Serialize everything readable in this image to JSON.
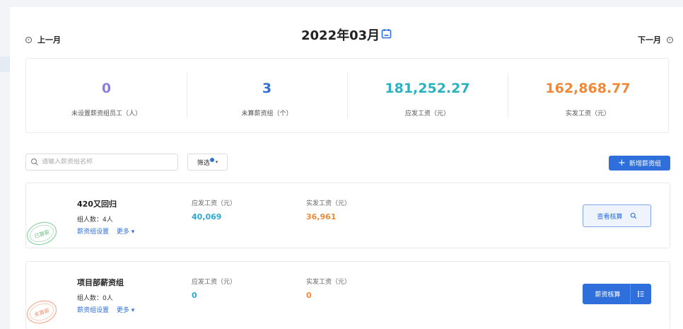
{
  "header": {
    "prev_label": "上一月",
    "month": "2022年03月",
    "next_label": "下一月"
  },
  "stats": [
    {
      "value": "0",
      "label": "未设置薪资组员工（人）",
      "color": "#8a7fe0"
    },
    {
      "value": "3",
      "label": "未算薪资组（个）",
      "color": "#2f6fdc"
    },
    {
      "value": "181,252.27",
      "label": "应发工资（元）",
      "color": "#2ab3bf"
    },
    {
      "value": "162,868.77",
      "label": "实发工资（元）",
      "color": "#f0883a"
    }
  ],
  "toolbar": {
    "search_placeholder": "请输入薪资组名称",
    "filter_label": "筛选",
    "add_label": "新增薪资组"
  },
  "groups": [
    {
      "name": "420又回归",
      "members": "组人数：4人",
      "settings_link": "薪资组设置",
      "more_link": "更多",
      "gross_label": "应发工资（元）",
      "gross_value": "40,069",
      "net_label": "实发工资（元）",
      "net_value": "36,961",
      "stamp": "已算薪",
      "action_label": "查看核算"
    },
    {
      "name": "项目部薪资组",
      "members": "组人数：0人",
      "settings_link": "薪资组设置",
      "more_link": "更多",
      "gross_label": "应发工资（元）",
      "gross_value": "0",
      "net_label": "实发工资（元）",
      "net_value": "0",
      "stamp": "未算薪",
      "action_label": "薪资核算"
    }
  ],
  "colors": {
    "primary": "#2f6fdc",
    "stamp_done": "#6cc28a",
    "stamp_pending": "#f0936e"
  }
}
